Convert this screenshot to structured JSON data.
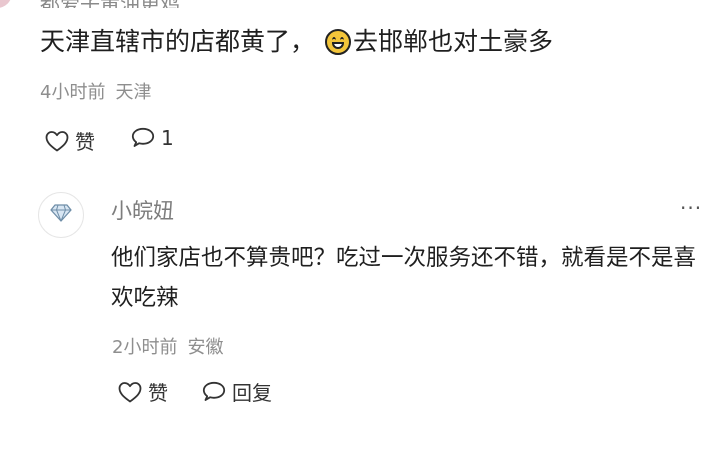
{
  "top_comment_cut": {
    "partial_text": "都爱子黄油更鸡"
  },
  "comment": {
    "text_before_emoji": "天津直辖市的店都黄了，",
    "emoji_icon": "grinning-face-emoji",
    "text_after_emoji": "去邯郸也对土豪多",
    "time": "4小时前",
    "location": "天津",
    "like_label": "赞",
    "reply_count": "1"
  },
  "reply": {
    "username": "小皖妞",
    "more": "···",
    "text": "他们家店也不算贵吧？吃过一次服务还不错，就看是不是喜欢吃辣",
    "time": "2小时前",
    "location": "安徽",
    "like_label": "赞",
    "reply_label": "回复"
  }
}
